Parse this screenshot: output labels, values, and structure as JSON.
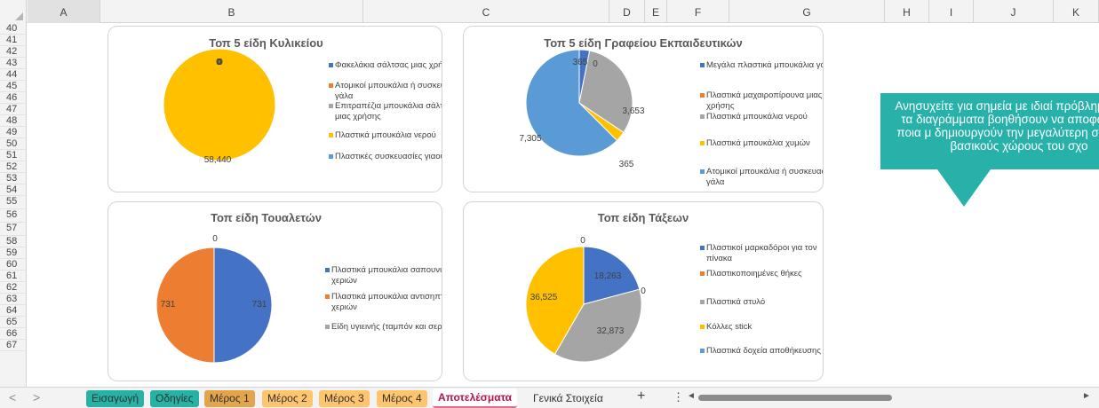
{
  "columns": [
    "A",
    "B",
    "C",
    "D",
    "E",
    "F",
    "G",
    "H",
    "I",
    "J",
    "K"
  ],
  "selected_column": "A",
  "rows": [
    "40",
    "41",
    "42",
    "43",
    "44",
    "45",
    "46",
    "47",
    "48",
    "49",
    "50",
    "51",
    "52",
    "53",
    "54",
    "55",
    "56",
    "57",
    "58",
    "59",
    "60",
    "61",
    "62",
    "63",
    "64",
    "65",
    "66",
    "67"
  ],
  "charts": {
    "kyliko": {
      "title": "Τοπ 5 είδη Κυλικείου",
      "legend": [
        "Φακελάκια σάλτσας μιας χρήσης",
        "Ατομικοί μπουκάλια ή συσκευασίες γάλα",
        "Επιτραπέζια μπουκάλια σάλτσας μιας χρήσης",
        "Πλαστικά μπουκάλια νερού",
        "Πλαστικές συσκευασίες γιαουρτιού"
      ],
      "colors": [
        "#4472c4",
        "#ed7d31",
        "#a5a5a5",
        "#ffc000",
        "#5b9bd5"
      ],
      "labels": [
        "0",
        "0",
        "0",
        "58,440",
        "0"
      ],
      "values": [
        0,
        0,
        0,
        58440,
        0
      ]
    },
    "grafeio": {
      "title": "Τοπ 5 είδη Γραφείου Εκπαιδευτικών",
      "legend": [
        "Μεγάλα πλαστικά μπουκάλια γάλα",
        "Πλαστικά μαχαιροπίρουνα μιας χρήσης",
        "Πλαστικά μπουκάλια νερού",
        "Πλαστικά μπουκάλια χυμών",
        "Ατομικοί μπουκάλια ή συσκευασίες γάλα"
      ],
      "colors": [
        "#4472c4",
        "#ed7d31",
        "#a5a5a5",
        "#ffc000",
        "#5b9bd5"
      ],
      "labels": [
        "365",
        "0",
        "3,653",
        "365",
        "7,305"
      ],
      "values": [
        365,
        0,
        3653,
        365,
        7305
      ]
    },
    "toualetes": {
      "title": "Τοπ είδη Τουαλετών",
      "legend": [
        "Πλαστικά μπουκάλια σαπουνιού χεριών",
        "Πλαστικά μπουκάλια αντισηπτικού χεριών",
        "Είδη υγιεινής (ταμπόν και σερβιέτες)"
      ],
      "colors": [
        "#4472c4",
        "#ed7d31",
        "#a5a5a5"
      ],
      "labels": [
        "731",
        "731",
        "0"
      ],
      "values": [
        731,
        731,
        0
      ]
    },
    "takseis": {
      "title": "Τοπ είδη Τάξεων",
      "legend": [
        "Πλαστικοί μαρκαδόροι για τον πίνακα",
        "Πλαστικοποιημένες θήκες",
        "Πλαστικά στυλό",
        "Κόλλες stick",
        "Πλαστικά δοχεία αποθήκευσης"
      ],
      "colors": [
        "#4472c4",
        "#ed7d31",
        "#a5a5a5",
        "#ffc000",
        "#5b9bd5"
      ],
      "labels": [
        "18,263",
        "0",
        "32,873",
        "36,525",
        "0"
      ],
      "values": [
        18263,
        0,
        32873,
        36525,
        0
      ]
    }
  },
  "callout": {
    "text": "Ανησυχείτε για σημεία με ιδιαί πρόβλημα; Αυτά τα διαγράμματα βοηθήσουν να αποφασίσετε ποια μ δημιουργούν την μεγαλύτερη σπ στους βασικούς χώρους του σχο"
  },
  "tabs": [
    "Εισαγωγή",
    "Οδηγίες",
    "Μέρος 1",
    "Μέρος 2",
    "Μέρος 3",
    "Μέρος 4",
    "Αποτελέσματα",
    "Γενικά Στοιχεία"
  ],
  "tab_colors": [
    "#26b3a5",
    "#26b3a5",
    "#e2a54c",
    "#ffc56e",
    "#ffc56e",
    "#ffc56e",
    "",
    ""
  ],
  "active_tab": "Αποτελέσματα",
  "nav": {
    "prev": "<",
    "next": ">",
    "add": "+",
    "more": "⋮",
    "scroll_left": "◄",
    "scroll_right": "►"
  }
}
